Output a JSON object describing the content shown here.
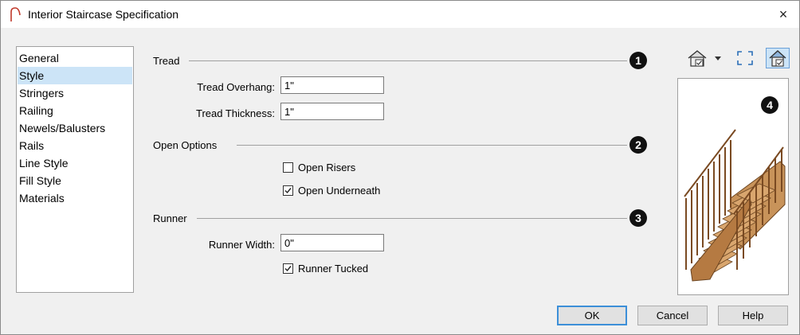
{
  "window": {
    "title": "Interior Staircase Specification",
    "close_glyph": "×"
  },
  "nav": {
    "items": [
      {
        "label": "General"
      },
      {
        "label": "Style"
      },
      {
        "label": "Stringers"
      },
      {
        "label": "Railing"
      },
      {
        "label": "Newels/Balusters"
      },
      {
        "label": "Rails"
      },
      {
        "label": "Line Style"
      },
      {
        "label": "Fill Style"
      },
      {
        "label": "Materials"
      }
    ],
    "selected": "Style"
  },
  "tread": {
    "title": "Tread",
    "badge": "1",
    "overhang_label": "Tread Overhang:",
    "overhang_value": "1\"",
    "thickness_label": "Tread Thickness:",
    "thickness_value": "1\""
  },
  "open_options": {
    "title": "Open Options",
    "badge": "2",
    "open_risers_label": "Open Risers",
    "open_risers_checked": false,
    "open_underneath_label": "Open Underneath",
    "open_underneath_checked": true
  },
  "runner": {
    "title": "Runner",
    "badge": "3",
    "width_label": "Runner Width:",
    "width_value": "0\"",
    "tucked_label": "Runner Tucked",
    "tucked_checked": true
  },
  "preview": {
    "badge": "4",
    "icons": [
      "house-view-icon",
      "fit-to-window-icon",
      "color-view-icon"
    ]
  },
  "buttons": {
    "ok": "OK",
    "cancel": "Cancel",
    "help": "Help"
  },
  "colors": {
    "accent": "#3c8fd8",
    "selection": "#cce4f7",
    "wood": "#c8935a"
  }
}
